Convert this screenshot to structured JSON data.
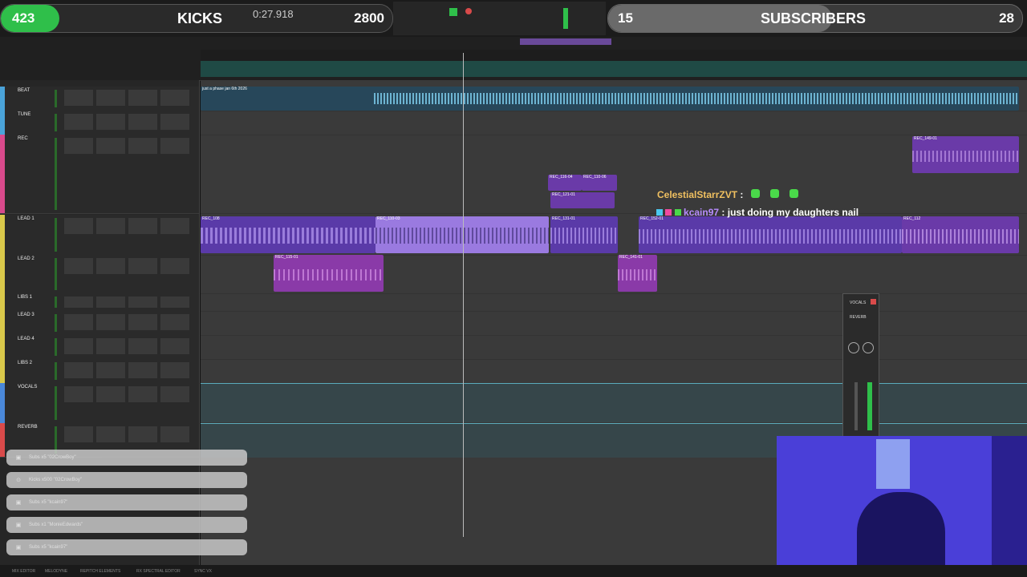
{
  "overlay": {
    "kicks_count": "423",
    "kicks_label": "KICKS",
    "kicks_goal": "2800",
    "kicks_progress": 0.15,
    "subs_count": "15",
    "subs_label": "SUBSCRIBERS",
    "subs_goal": "28",
    "subs_progress": 0.54
  },
  "transport": {
    "counter": "0:27.918"
  },
  "tracks": [
    {
      "name": "BEAT",
      "color": "#4aa3d9"
    },
    {
      "name": "TUNE",
      "color": "#4aa3d9"
    },
    {
      "name": "REC",
      "color": "#d94a8c"
    },
    {
      "name": "LEAD 1",
      "color": "#d9c84a"
    },
    {
      "name": "LEAD 2",
      "color": "#d9c84a"
    },
    {
      "name": "LIBS 1",
      "color": "#d9c84a"
    },
    {
      "name": "LEAD 3",
      "color": "#d9c84a"
    },
    {
      "name": "LEAD 4",
      "color": "#d9c84a"
    },
    {
      "name": "LIBS 2",
      "color": "#d9c84a"
    },
    {
      "name": "VOCALS",
      "color": "#4a88d9"
    },
    {
      "name": "REVERB",
      "color": "#d94a4a"
    }
  ],
  "clips": {
    "beat": "just a phase jan 6th 2026",
    "rec_a": "REC_149-01",
    "rec_b": "REC_116-04",
    "rec_c": "REC_110-06",
    "rec_d": "REC_121-01",
    "lead1_a": "REC_108",
    "lead1_b": "REC_110-03",
    "lead1_c": "REC_131-01",
    "lead1_d": "REC_152-01",
    "lead1_e": "REC_112",
    "lead2_a": "REC_115-01",
    "lead2_b": "REC_141-01"
  },
  "chat": [
    {
      "user": "CelestialStarrZVT",
      "text": ":",
      "emotes": 3,
      "color": "#f0c060"
    },
    {
      "user": "kcain97",
      "text": ": just doing my daughters nail",
      "color": "#b78cff"
    }
  ],
  "alerts": [
    {
      "icon": "gift-icon",
      "text": "Subs x5 \"02CrowBoy\""
    },
    {
      "icon": "kick-icon",
      "text": "Kicks x500 \"02CrowBoy\""
    },
    {
      "icon": "gift-icon",
      "text": "Subs x5 \"kcain97\""
    },
    {
      "icon": "gift-icon",
      "text": "Subs x1 \"MonieEdwards\""
    },
    {
      "icon": "gift-icon",
      "text": "Subs x5 \"kcain97\""
    }
  ],
  "plugin": {
    "title": "VOCALS",
    "insert": "REVERB"
  },
  "bottom": {
    "items": [
      "MIX EDITOR",
      "MELODYNE",
      "REPITCH ELEMENTS",
      "RX SPECTRAL EDITOR",
      "SYNC VX"
    ]
  }
}
